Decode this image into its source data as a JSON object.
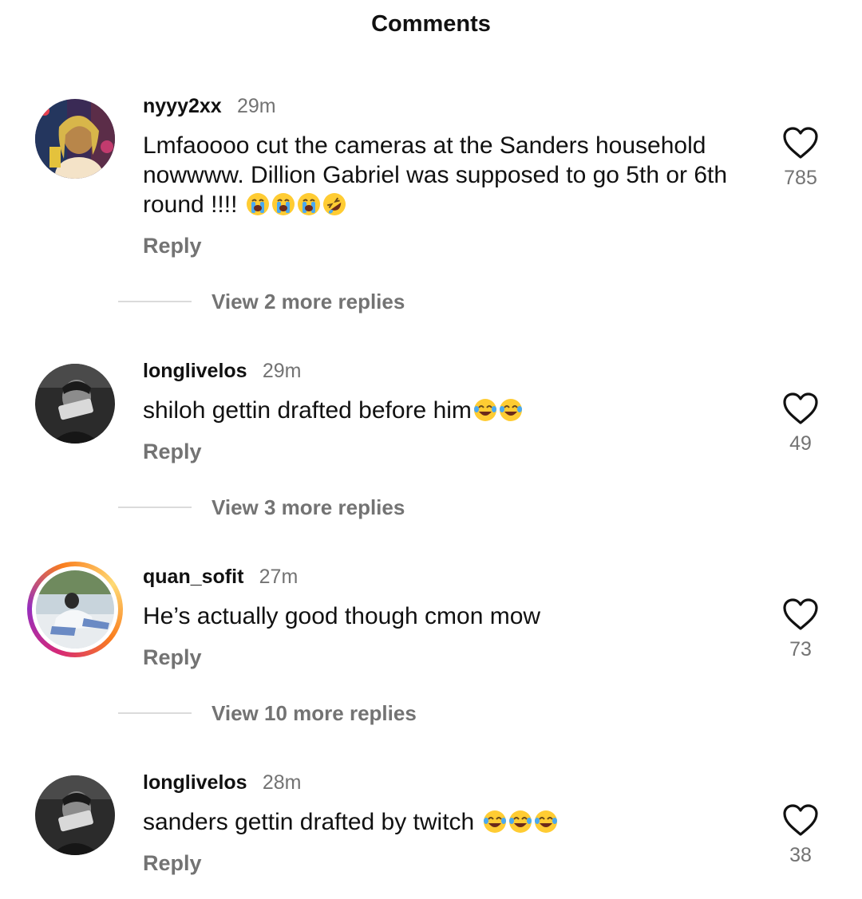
{
  "header": {
    "title": "Comments"
  },
  "comments": [
    {
      "username": "nyyy2xx",
      "time": "29m",
      "text": "Lmfaoooo cut the cameras at the Sanders household nowwww. Dillion Gabriel was supposed to go 5th or 6th round !!!!",
      "emojis": [
        "loudly-crying-face",
        "loudly-crying-face",
        "loudly-crying-face",
        "rolling-on-floor-laughing"
      ],
      "reply_label": "Reply",
      "likes": "785",
      "view_replies": "View 2 more replies",
      "has_story": false
    },
    {
      "username": "longlivelos",
      "time": "29m",
      "text": "shiloh gettin drafted before him",
      "emojis": [
        "face-with-tears-of-joy",
        "face-with-tears-of-joy"
      ],
      "reply_label": "Reply",
      "likes": "49",
      "view_replies": "View 3 more replies",
      "has_story": false
    },
    {
      "username": "quan_sofit",
      "time": "27m",
      "text": "He’s actually good though cmon mow",
      "emojis": [],
      "reply_label": "Reply",
      "likes": "73",
      "view_replies": "View 10 more replies",
      "has_story": true
    },
    {
      "username": "longlivelos",
      "time": "28m",
      "text": "sanders gettin drafted by twitch ",
      "emojis": [
        "face-with-tears-of-joy",
        "face-with-tears-of-joy",
        "face-with-tears-of-joy"
      ],
      "reply_label": "Reply",
      "likes": "38",
      "view_replies": "",
      "has_story": false
    }
  ],
  "icons": {
    "like": "heart-outline-icon"
  },
  "colors": {
    "primary_text": "#111111",
    "secondary_text": "#737373",
    "divider": "#dbdbdb",
    "emoji": "#FFCC33"
  }
}
